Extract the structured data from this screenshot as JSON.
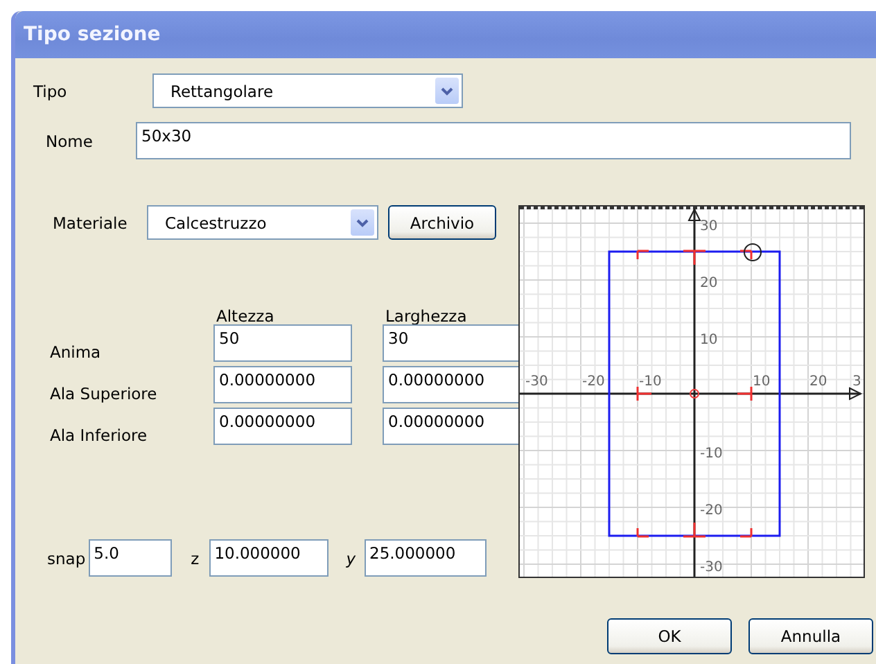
{
  "window": {
    "title": "Tipo sezione"
  },
  "tipo": {
    "label": "Tipo",
    "value": "Rettangolare"
  },
  "nome": {
    "label": "Nome",
    "value": "50x30"
  },
  "materiale": {
    "label": "Materiale",
    "value": "Calcestruzzo",
    "button": "Archivio"
  },
  "dimensions": {
    "columns": [
      "Altezza",
      "Larghezza"
    ],
    "rows": [
      {
        "label": "Anima",
        "values": [
          "50",
          "30"
        ]
      },
      {
        "label": "Ala Superiore",
        "values": [
          "0.00000000",
          "0.00000000"
        ]
      },
      {
        "label": "Ala Inferiore",
        "values": [
          "0.00000000",
          "0.00000000"
        ]
      }
    ]
  },
  "coords": [
    {
      "label": "snap",
      "value": "5.0"
    },
    {
      "label": "z",
      "value": "10.000000"
    },
    {
      "label": "y",
      "value": "25.000000"
    }
  ],
  "section_view": {
    "x_ticks": [
      "-30",
      "-20",
      "-10",
      "10",
      "20",
      "3"
    ],
    "y_ticks": [
      "30",
      "20",
      "10",
      "-10",
      "-20",
      "-30"
    ]
  },
  "buttons": [
    "OK",
    "Annulla"
  ]
}
